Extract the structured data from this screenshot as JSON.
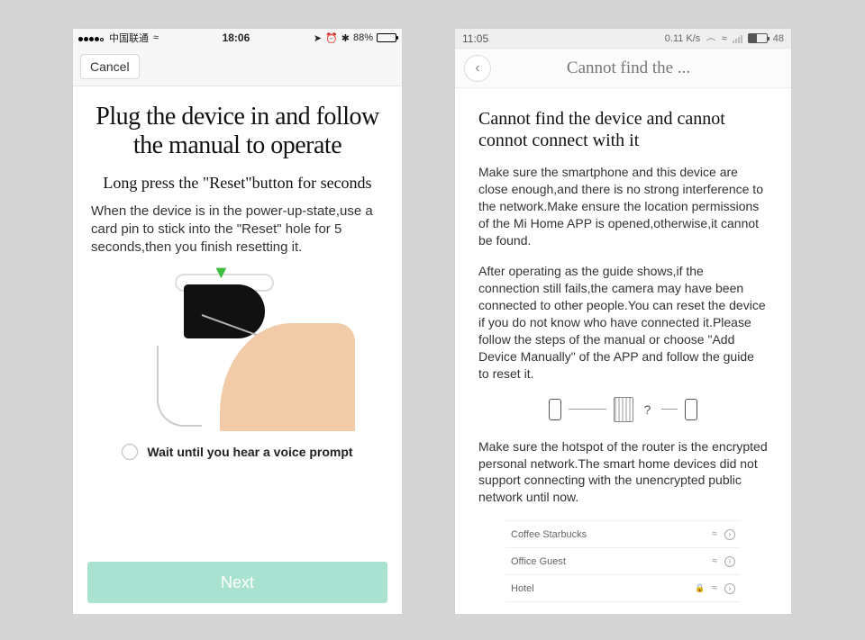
{
  "left": {
    "status": {
      "carrier": "中国联通",
      "time": "18:06",
      "battery_pct": "88%",
      "battery_fill": "88%"
    },
    "nav": {
      "cancel": "Cancel"
    },
    "heading": "Plug the device in and follow the manual to operate",
    "subheading": "Long press the \"Reset\"button for seconds",
    "body": "When the device is in the power-up-state,use a card pin to stick into the \"Reset\" hole for 5 seconds,then you finish resetting it.",
    "radio_label": "Wait until you hear a voice prompt",
    "next": "Next"
  },
  "right": {
    "status": {
      "time": "11:05",
      "net_speed": "0.11 K/s",
      "battery_num": "48",
      "battery_fill": "48%"
    },
    "nav_title": "Cannot find the ...",
    "heading": "Cannot find the device and cannot connot connect with it",
    "para1": "Make sure the smartphone and this device are close enough,and there is no strong interference to the network.Make ensure the location permissions of the Mi Home APP is opened,otherwise,it cannot be found.",
    "para2": "After operating as the guide shows,if the connection still fails,the camera may have been connected to other people.You can reset the device if you do not know who have connected it.Please follow the steps of the manual or choose \"Add Device Manually\" of the APP and follow the guide to reset it.",
    "para3": "Make sure the hotspot of the router is the encrypted personal network.The smart home devices did not support connecting with the unencrypted public network until now.",
    "wifi": [
      {
        "name": "Coffee Starbucks",
        "locked": false
      },
      {
        "name": "Office Guest",
        "locked": false
      },
      {
        "name": "Hotel",
        "locked": true
      }
    ]
  }
}
